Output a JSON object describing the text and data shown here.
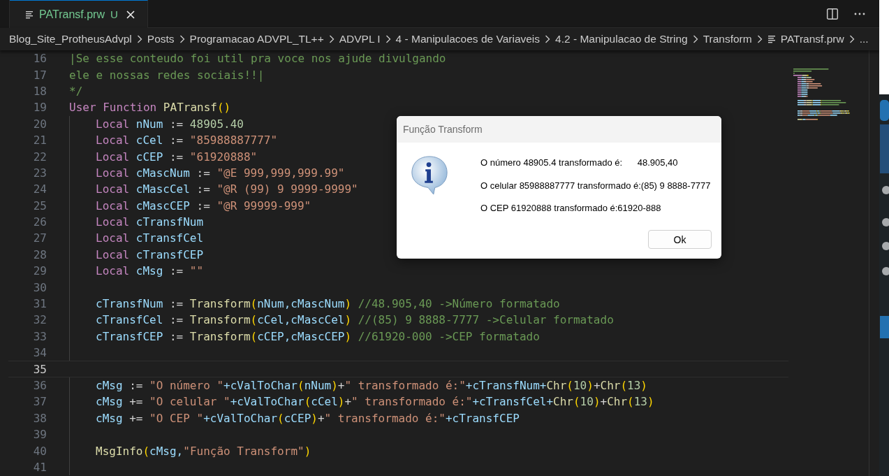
{
  "tab": {
    "label": "PATransf.prw",
    "badge": "U",
    "selected": true,
    "modified": true
  },
  "breadcrumbs": [
    {
      "label": "Blog_Site_ProtheusAdvpl",
      "kind": "folder"
    },
    {
      "label": "Posts",
      "kind": "folder"
    },
    {
      "label": "Programacao ADVPL_TL++",
      "kind": "folder"
    },
    {
      "label": "ADVPL I",
      "kind": "folder"
    },
    {
      "label": "4 - Manipulacoes de Variaveis",
      "kind": "folder"
    },
    {
      "label": "4.2 - Manipulacao de String",
      "kind": "folder"
    },
    {
      "label": "Transform",
      "kind": "folder"
    },
    {
      "label": "PATransf.prw",
      "kind": "file"
    },
    {
      "label": "...",
      "kind": "more"
    }
  ],
  "editor": {
    "lines": [
      {
        "number": "16",
        "current": false,
        "indented": false,
        "tokens": [
          {
            "kind": "cm",
            "t": "|Se esse conteudo foi util pra voce nos ajude divulgando"
          }
        ]
      },
      {
        "number": "17",
        "current": false,
        "indented": false,
        "tokens": [
          {
            "kind": "cm",
            "t": "ele e nossas redes sociais!!|"
          }
        ]
      },
      {
        "number": "18",
        "current": false,
        "indented": false,
        "tokens": [
          {
            "kind": "cm",
            "t": "*/"
          }
        ]
      },
      {
        "number": "19",
        "current": false,
        "indented": false,
        "tokens": [
          {
            "kind": "kw",
            "t": "User Function "
          },
          {
            "kind": "fn",
            "t": "PATransf"
          },
          {
            "kind": "br",
            "t": "()"
          }
        ]
      },
      {
        "number": "20",
        "current": false,
        "indented": true,
        "tokens": [
          {
            "kind": "kw",
            "t": "Local "
          },
          {
            "kind": "var",
            "t": "nNum"
          },
          {
            "kind": "op",
            "t": " := "
          },
          {
            "kind": "num",
            "t": "48905.40"
          }
        ]
      },
      {
        "number": "21",
        "current": false,
        "indented": true,
        "tokens": [
          {
            "kind": "kw",
            "t": "Local "
          },
          {
            "kind": "var",
            "t": "cCel"
          },
          {
            "kind": "op",
            "t": " := "
          },
          {
            "kind": "str",
            "t": "\"85988887777\""
          }
        ]
      },
      {
        "number": "22",
        "current": false,
        "indented": true,
        "tokens": [
          {
            "kind": "kw",
            "t": "Local "
          },
          {
            "kind": "var",
            "t": "cCEP"
          },
          {
            "kind": "op",
            "t": " := "
          },
          {
            "kind": "str",
            "t": "\"61920888\""
          }
        ]
      },
      {
        "number": "23",
        "current": false,
        "indented": true,
        "tokens": [
          {
            "kind": "kw",
            "t": "Local "
          },
          {
            "kind": "var",
            "t": "cMascNum"
          },
          {
            "kind": "op",
            "t": " := "
          },
          {
            "kind": "str",
            "t": "\"@E 999,999,999.99\""
          }
        ]
      },
      {
        "number": "24",
        "current": false,
        "indented": true,
        "tokens": [
          {
            "kind": "kw",
            "t": "Local "
          },
          {
            "kind": "var",
            "t": "cMascCel"
          },
          {
            "kind": "op",
            "t": " := "
          },
          {
            "kind": "str",
            "t": "\"@R (99) 9 9999-9999\""
          }
        ]
      },
      {
        "number": "25",
        "current": false,
        "indented": true,
        "tokens": [
          {
            "kind": "kw",
            "t": "Local "
          },
          {
            "kind": "var",
            "t": "cMascCEP"
          },
          {
            "kind": "op",
            "t": " := "
          },
          {
            "kind": "str",
            "t": "\"@R 99999-999\""
          }
        ]
      },
      {
        "number": "26",
        "current": false,
        "indented": true,
        "tokens": [
          {
            "kind": "kw",
            "t": "Local "
          },
          {
            "kind": "var",
            "t": "cTransfNum"
          }
        ]
      },
      {
        "number": "27",
        "current": false,
        "indented": true,
        "tokens": [
          {
            "kind": "kw",
            "t": "Local "
          },
          {
            "kind": "var",
            "t": "cTransfCel"
          }
        ]
      },
      {
        "number": "28",
        "current": false,
        "indented": true,
        "tokens": [
          {
            "kind": "kw",
            "t": "Local "
          },
          {
            "kind": "var",
            "t": "cTransfCEP"
          }
        ]
      },
      {
        "number": "29",
        "current": false,
        "indented": true,
        "tokens": [
          {
            "kind": "kw",
            "t": "Local "
          },
          {
            "kind": "var",
            "t": "cMsg"
          },
          {
            "kind": "op",
            "t": " := "
          },
          {
            "kind": "str",
            "t": "\"\""
          }
        ]
      },
      {
        "number": "30",
        "current": false,
        "indented": true
      },
      {
        "number": "31",
        "current": false,
        "indented": true,
        "tokens": [
          {
            "kind": "var",
            "t": "cTransfNum"
          },
          {
            "kind": "op",
            "t": " := "
          },
          {
            "kind": "fn",
            "t": "Transform"
          },
          {
            "kind": "br",
            "t": "("
          },
          {
            "kind": "var",
            "t": "nNum,cMascNum"
          },
          {
            "kind": "br",
            "t": ")"
          },
          {
            "kind": "cm",
            "t": " //48.905,40 ->Número formatado"
          }
        ]
      },
      {
        "number": "32",
        "current": false,
        "indented": true,
        "tokens": [
          {
            "kind": "var",
            "t": "cTransfCel"
          },
          {
            "kind": "op",
            "t": " := "
          },
          {
            "kind": "fn",
            "t": "Transform"
          },
          {
            "kind": "br",
            "t": "("
          },
          {
            "kind": "var",
            "t": "cCel,cMascCel"
          },
          {
            "kind": "br",
            "t": ")"
          },
          {
            "kind": "cm",
            "t": " //(85) 9 8888-7777 ->Celular formatado"
          }
        ]
      },
      {
        "number": "33",
        "current": false,
        "indented": true,
        "tokens": [
          {
            "kind": "var",
            "t": "cTransfCEP"
          },
          {
            "kind": "op",
            "t": " := "
          },
          {
            "kind": "fn",
            "t": "Transform"
          },
          {
            "kind": "br",
            "t": "("
          },
          {
            "kind": "var",
            "t": "cCEP,cMascCEP"
          },
          {
            "kind": "br",
            "t": ")"
          },
          {
            "kind": "cm",
            "t": " //61920-000 ->CEP formatado"
          }
        ]
      },
      {
        "number": "34",
        "current": false,
        "indented": true
      },
      {
        "number": "35",
        "current": true,
        "indented": false
      },
      {
        "number": "36",
        "current": false,
        "indented": true,
        "tokens": [
          {
            "kind": "var",
            "t": "cMsg"
          },
          {
            "kind": "op",
            "t": " := "
          },
          {
            "kind": "str",
            "t": "\"O número \""
          },
          {
            "kind": "var",
            "t": "+cValToChar"
          },
          {
            "kind": "br",
            "t": "("
          },
          {
            "kind": "var",
            "t": "nNum"
          },
          {
            "kind": "br",
            "t": ")"
          },
          {
            "kind": "op",
            "t": "+"
          },
          {
            "kind": "str",
            "t": "\" transformado é:\""
          },
          {
            "kind": "var",
            "t": "+cTransfNum+"
          },
          {
            "kind": "fn",
            "t": "Chr"
          },
          {
            "kind": "br",
            "t": "("
          },
          {
            "kind": "num",
            "t": "10"
          },
          {
            "kind": "br",
            "t": ")"
          },
          {
            "kind": "op",
            "t": "+"
          },
          {
            "kind": "fn",
            "t": "Chr"
          },
          {
            "kind": "br",
            "t": "("
          },
          {
            "kind": "num",
            "t": "13"
          },
          {
            "kind": "br",
            "t": ")"
          }
        ]
      },
      {
        "number": "37",
        "current": false,
        "indented": true,
        "tokens": [
          {
            "kind": "var",
            "t": "cMsg"
          },
          {
            "kind": "op",
            "t": " += "
          },
          {
            "kind": "str",
            "t": "\"O celular \""
          },
          {
            "kind": "var",
            "t": "+cValToChar"
          },
          {
            "kind": "br",
            "t": "("
          },
          {
            "kind": "var",
            "t": "cCel"
          },
          {
            "kind": "br",
            "t": ")"
          },
          {
            "kind": "op",
            "t": "+"
          },
          {
            "kind": "str",
            "t": "\" transformado é:\""
          },
          {
            "kind": "var",
            "t": "+cTransfCel+"
          },
          {
            "kind": "fn",
            "t": "Chr"
          },
          {
            "kind": "br",
            "t": "("
          },
          {
            "kind": "num",
            "t": "10"
          },
          {
            "kind": "br",
            "t": ")"
          },
          {
            "kind": "op",
            "t": "+"
          },
          {
            "kind": "fn",
            "t": "Chr"
          },
          {
            "kind": "br",
            "t": "("
          },
          {
            "kind": "num",
            "t": "13"
          },
          {
            "kind": "br",
            "t": ")"
          }
        ]
      },
      {
        "number": "38",
        "current": false,
        "indented": true,
        "tokens": [
          {
            "kind": "var",
            "t": "cMsg"
          },
          {
            "kind": "op",
            "t": " += "
          },
          {
            "kind": "str",
            "t": "\"O CEP \""
          },
          {
            "kind": "var",
            "t": "+cValToChar"
          },
          {
            "kind": "br",
            "t": "("
          },
          {
            "kind": "var",
            "t": "cCEP"
          },
          {
            "kind": "br",
            "t": ")"
          },
          {
            "kind": "op",
            "t": "+"
          },
          {
            "kind": "str",
            "t": "\" transformado é:\""
          },
          {
            "kind": "var",
            "t": "+cTransfCEP"
          }
        ]
      },
      {
        "number": "39",
        "current": false,
        "indented": true
      },
      {
        "number": "40",
        "current": false,
        "indented": true,
        "tokens": [
          {
            "kind": "fn",
            "t": "MsgInfo"
          },
          {
            "kind": "br",
            "t": "("
          },
          {
            "kind": "var",
            "t": "cMsg,"
          },
          {
            "kind": "str",
            "t": "\"Função Transform\""
          },
          {
            "kind": "br",
            "t": ")"
          }
        ]
      },
      {
        "number": "41",
        "current": false,
        "indented": true
      }
    ]
  },
  "dialog": {
    "title": "Função Transform",
    "messages": [
      "O número 48905.4 transformado é:      48.905,40",
      "O celular 85988887777 transformado é:(85) 9 8888-7777",
      "O CEP 61920888 transformado é:61920-888"
    ],
    "button": "Ok"
  }
}
